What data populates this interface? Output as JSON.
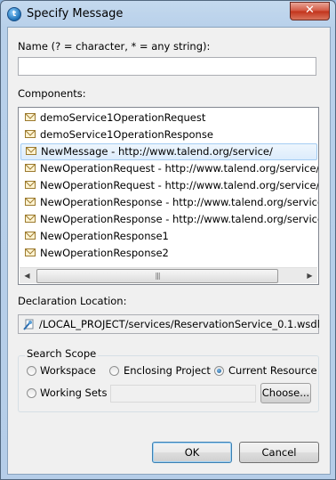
{
  "window": {
    "title": "Specify Message",
    "close_glyph": "✕",
    "app_icon_glyph": "t"
  },
  "name_field": {
    "label": "Name (? = character, * = any string):",
    "value": ""
  },
  "components": {
    "label": "Components:",
    "items": [
      {
        "text": "demoService1OperationRequest",
        "selected": false
      },
      {
        "text": "demoService1OperationResponse",
        "selected": false
      },
      {
        "text": "NewMessage - http://www.talend.org/service/",
        "selected": true
      },
      {
        "text": "NewOperationRequest - http://www.talend.org/service/",
        "selected": false
      },
      {
        "text": "NewOperationRequest - http://www.talend.org/service/",
        "selected": false
      },
      {
        "text": "NewOperationResponse - http://www.talend.org/service/",
        "selected": false
      },
      {
        "text": "NewOperationResponse - http://www.talend.org/service/",
        "selected": false
      },
      {
        "text": "NewOperationResponse1",
        "selected": false
      },
      {
        "text": "NewOperationResponse2",
        "selected": false
      }
    ],
    "scroll_left_glyph": "◀",
    "scroll_right_glyph": "▶",
    "scroll_grip": "|||"
  },
  "declaration": {
    "label": "Declaration Location:",
    "value": "/LOCAL_PROJECT/services/ReservationService_0.1.wsdl"
  },
  "search_scope": {
    "title": "Search Scope",
    "workspace": "Workspace",
    "enclosing_project": "Enclosing Project",
    "current_resource": "Current Resource",
    "working_sets": "Working Sets",
    "selected": "current_resource",
    "choose_button": "Choose...",
    "working_sets_value": ""
  },
  "buttons": {
    "ok": "OK",
    "cancel": "Cancel"
  },
  "colors": {
    "selection_border": "#a4cdf3",
    "title_bar": "#b8d0ea",
    "close_button": "#c2321a"
  }
}
